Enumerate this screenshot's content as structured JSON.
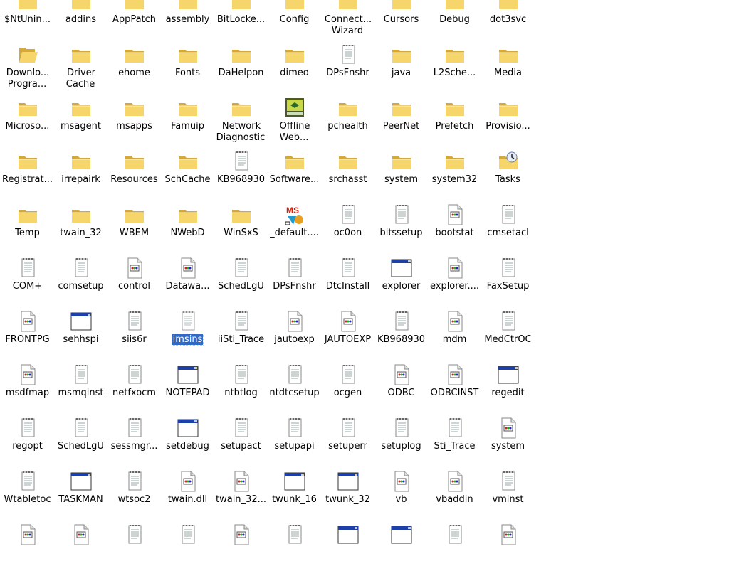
{
  "items": [
    {
      "label": "$NtUnin...",
      "icon": "folder-icon"
    },
    {
      "label": "addins",
      "icon": "folder-icon"
    },
    {
      "label": "AppPatch",
      "icon": "folder-icon"
    },
    {
      "label": "assembly",
      "icon": "folder-icon"
    },
    {
      "label": "BitLocke...",
      "icon": "folder-icon"
    },
    {
      "label": "Config",
      "icon": "folder-icon"
    },
    {
      "label": "Connect... Wizard",
      "icon": "folder-icon"
    },
    {
      "label": "Cursors",
      "icon": "folder-icon"
    },
    {
      "label": "Debug",
      "icon": "folder-icon"
    },
    {
      "label": "dot3svc",
      "icon": "folder-icon"
    },
    {
      "label": "Downlo... Progra...",
      "icon": "open-folder-icon"
    },
    {
      "label": "Driver Cache",
      "icon": "folder-icon"
    },
    {
      "label": "ehome",
      "icon": "folder-icon"
    },
    {
      "label": "Fonts",
      "icon": "folder-icon"
    },
    {
      "label": "DaHelpon",
      "icon": "folder-icon"
    },
    {
      "label": "dimeo",
      "icon": "folder-icon"
    },
    {
      "label": "DPsFnshr",
      "icon": "notepad-file-icon"
    },
    {
      "label": "java",
      "icon": "folder-icon"
    },
    {
      "label": "L2Sche...",
      "icon": "folder-icon"
    },
    {
      "label": "Media",
      "icon": "folder-icon"
    },
    {
      "label": "Microso...",
      "icon": "folder-icon"
    },
    {
      "label": "msagent",
      "icon": "folder-icon"
    },
    {
      "label": "msapps",
      "icon": "folder-icon"
    },
    {
      "label": "Famuip",
      "icon": "folder-icon"
    },
    {
      "label": "Network Diagnostic",
      "icon": "folder-icon"
    },
    {
      "label": "Offline Web...",
      "icon": "offline-web-icon"
    },
    {
      "label": "pchealth",
      "icon": "folder-icon"
    },
    {
      "label": "PeerNet",
      "icon": "folder-icon"
    },
    {
      "label": "Prefetch",
      "icon": "folder-icon"
    },
    {
      "label": "Provisio...",
      "icon": "folder-icon"
    },
    {
      "label": "Registrat...",
      "icon": "folder-icon"
    },
    {
      "label": "irrepairk",
      "icon": "folder-icon"
    },
    {
      "label": "Resources",
      "icon": "folder-icon"
    },
    {
      "label": "SchCache",
      "icon": "folder-icon"
    },
    {
      "label": "KB968930",
      "icon": "notepad-file-icon"
    },
    {
      "label": "Software...",
      "icon": "folder-icon"
    },
    {
      "label": "srchasst",
      "icon": "folder-icon"
    },
    {
      "label": "system",
      "icon": "folder-icon"
    },
    {
      "label": "system32",
      "icon": "folder-icon"
    },
    {
      "label": "Tasks",
      "icon": "tasks-folder-icon"
    },
    {
      "label": "Temp",
      "icon": "folder-icon"
    },
    {
      "label": "twain_32",
      "icon": "folder-icon"
    },
    {
      "label": "WBEM",
      "icon": "folder-icon"
    },
    {
      "label": "NWebD",
      "icon": "folder-icon"
    },
    {
      "label": "WinSxS",
      "icon": "folder-icon"
    },
    {
      "label": "_default....",
      "icon": "ms-app-icon"
    },
    {
      "label": "oc0on",
      "icon": "notepad-file-icon"
    },
    {
      "label": "bitssetup",
      "icon": "notepad-file-icon"
    },
    {
      "label": "bootstat",
      "icon": "app-file-icon"
    },
    {
      "label": "cmsetacl",
      "icon": "notepad-file-icon"
    },
    {
      "label": "COM+",
      "icon": "notepad-file-icon"
    },
    {
      "label": "comsetup",
      "icon": "notepad-file-icon"
    },
    {
      "label": "control",
      "icon": "app-file-icon"
    },
    {
      "label": "Datawa...",
      "icon": "app-file-icon"
    },
    {
      "label": "SchedLgU",
      "icon": "notepad-file-icon"
    },
    {
      "label": "DPsFnshr",
      "icon": "notepad-file-icon"
    },
    {
      "label": "DtcInstall",
      "icon": "notepad-file-icon"
    },
    {
      "label": "explorer",
      "icon": "window-icon"
    },
    {
      "label": "explorer....",
      "icon": "app-file-icon"
    },
    {
      "label": "FaxSetup",
      "icon": "notepad-file-icon"
    },
    {
      "label": "FRONTPG",
      "icon": "app-file-icon"
    },
    {
      "label": "sehhspi",
      "icon": "window-icon"
    },
    {
      "label": "siis6r",
      "icon": "notepad-file-icon"
    },
    {
      "label": "imsins",
      "icon": "notepad-file-icon",
      "selected": true
    },
    {
      "label": "iiSti_Trace",
      "icon": "notepad-file-icon"
    },
    {
      "label": "jautoexp",
      "icon": "app-file-icon"
    },
    {
      "label": "JAUTOEXP",
      "icon": "app-file-icon"
    },
    {
      "label": "KB968930",
      "icon": "notepad-file-icon"
    },
    {
      "label": "mdm",
      "icon": "app-file-icon"
    },
    {
      "label": "MedCtrOC",
      "icon": "notepad-file-icon"
    },
    {
      "label": "msdfmap",
      "icon": "app-file-icon"
    },
    {
      "label": "msmqinst",
      "icon": "notepad-file-icon"
    },
    {
      "label": "netfxocm",
      "icon": "notepad-file-icon"
    },
    {
      "label": "NOTEPAD",
      "icon": "window-icon"
    },
    {
      "label": "ntbtlog",
      "icon": "notepad-file-icon"
    },
    {
      "label": "ntdtcsetup",
      "icon": "notepad-file-icon"
    },
    {
      "label": "ocgen",
      "icon": "notepad-file-icon"
    },
    {
      "label": "ODBC",
      "icon": "app-file-icon"
    },
    {
      "label": "ODBCINST",
      "icon": "app-file-icon"
    },
    {
      "label": "regedit",
      "icon": "window-icon"
    },
    {
      "label": "regopt",
      "icon": "notepad-file-icon"
    },
    {
      "label": "SchedLgU",
      "icon": "notepad-file-icon"
    },
    {
      "label": "sessmgr...",
      "icon": "notepad-file-icon"
    },
    {
      "label": "setdebug",
      "icon": "window-icon"
    },
    {
      "label": "setupact",
      "icon": "notepad-file-icon"
    },
    {
      "label": "setupapi",
      "icon": "notepad-file-icon"
    },
    {
      "label": "setuperr",
      "icon": "notepad-file-icon"
    },
    {
      "label": "setuplog",
      "icon": "notepad-file-icon"
    },
    {
      "label": "Sti_Trace",
      "icon": "notepad-file-icon"
    },
    {
      "label": "system",
      "icon": "app-file-icon"
    },
    {
      "label": "Wtabletoc",
      "icon": "notepad-file-icon"
    },
    {
      "label": "TASKMAN",
      "icon": "window-icon"
    },
    {
      "label": "wtsoc2",
      "icon": "notepad-file-icon"
    },
    {
      "label": "twain.dll",
      "icon": "app-file-icon"
    },
    {
      "label": "twain_32...",
      "icon": "app-file-icon"
    },
    {
      "label": "twunk_16",
      "icon": "window-icon"
    },
    {
      "label": "twunk_32",
      "icon": "window-icon"
    },
    {
      "label": "vb",
      "icon": "app-file-icon"
    },
    {
      "label": "vbaddin",
      "icon": "app-file-icon"
    },
    {
      "label": "vminst",
      "icon": "notepad-file-icon"
    },
    {
      "label": "",
      "icon": "app-file-icon"
    },
    {
      "label": "",
      "icon": "app-file-icon"
    },
    {
      "label": "",
      "icon": "notepad-file-icon"
    },
    {
      "label": "",
      "icon": "notepad-file-icon"
    },
    {
      "label": "",
      "icon": "app-file-icon"
    },
    {
      "label": "",
      "icon": "notepad-file-icon"
    },
    {
      "label": "",
      "icon": "window-icon"
    },
    {
      "label": "",
      "icon": "window-icon"
    },
    {
      "label": "",
      "icon": "notepad-file-icon"
    },
    {
      "label": "",
      "icon": "app-file-icon"
    }
  ],
  "colors": {
    "folder": "#f6d66a",
    "folder_dark": "#d4a93a",
    "selection": "#316ac5",
    "window_title": "#1c3fa8"
  }
}
